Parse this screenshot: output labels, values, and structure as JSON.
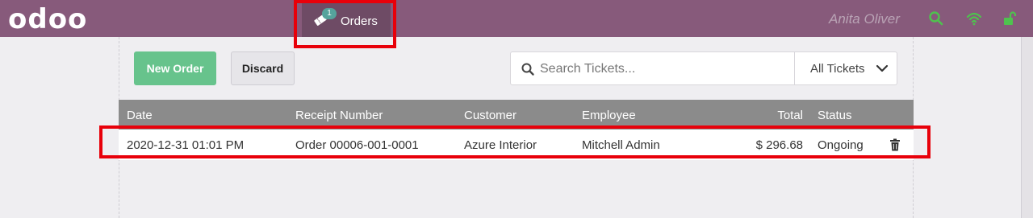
{
  "topbar": {
    "logo": "odoo",
    "orders_tab_label": "Orders",
    "orders_badge": "1",
    "user_name": "Anita Oliver",
    "colors": {
      "bar": "#875a7b",
      "active_tab": "#6e4b65",
      "icon_green": "#4ec24e"
    }
  },
  "toolbar": {
    "new_order_label": "New Order",
    "discard_label": "Discard"
  },
  "search": {
    "placeholder": "Search Tickets...",
    "filter_value": "All Tickets"
  },
  "table": {
    "headers": [
      "Date",
      "Receipt Number",
      "Customer",
      "Employee",
      "Total",
      "Status"
    ],
    "rows": [
      {
        "date": "2020-12-31 01:01 PM",
        "receipt": "Order 00006-001-0001",
        "customer": "Azure Interior",
        "employee": "Mitchell Admin",
        "total": "$ 296.68",
        "status": "Ongoing"
      }
    ]
  }
}
